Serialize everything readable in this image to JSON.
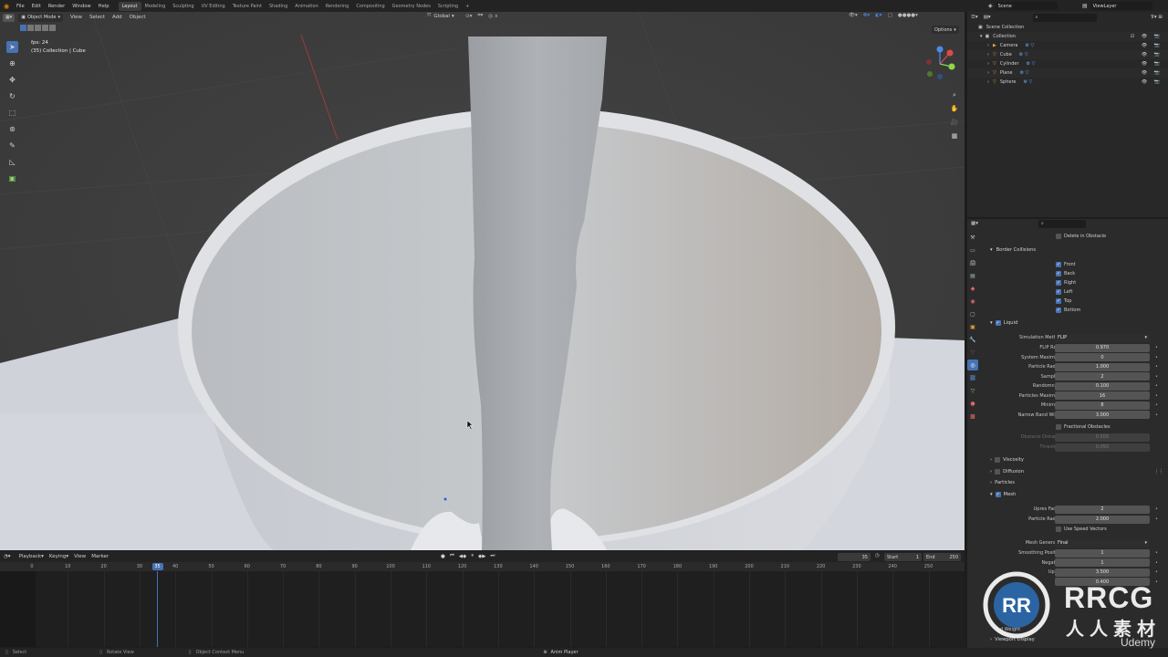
{
  "topbar": {
    "menus": [
      "File",
      "Edit",
      "Render",
      "Window",
      "Help"
    ],
    "workspaces": [
      "Layout",
      "Modeling",
      "Sculpting",
      "UV Editing",
      "Texture Paint",
      "Shading",
      "Animation",
      "Rendering",
      "Compositing",
      "Geometry Nodes",
      "Scripting"
    ],
    "active_workspace": "Layout",
    "add_workspace": "+",
    "scene": "Scene",
    "view_layer": "ViewLayer"
  },
  "viewport": {
    "mode": "Object Mode",
    "menus": [
      "View",
      "Select",
      "Add",
      "Object"
    ],
    "transform_orientation": "Global",
    "options_label": "Options",
    "overlay_fps": "fps: 24",
    "overlay_info": "(35) Collection | Cube"
  },
  "outliner": {
    "scene_collection": "Scene Collection",
    "collection": "Collection",
    "items": [
      {
        "label": "Camera",
        "icon": "camera-icon"
      },
      {
        "label": "Cube",
        "icon": "mesh-icon"
      },
      {
        "label": "Cylinder",
        "icon": "mesh-icon"
      },
      {
        "label": "Plane",
        "icon": "mesh-icon"
      },
      {
        "label": "Sphere",
        "icon": "mesh-icon"
      }
    ]
  },
  "properties": {
    "delete_in_obstacle": "Delete in Obstacle",
    "border_collisions": {
      "title": "Border Collisions",
      "items": [
        "Front",
        "Back",
        "Right",
        "Left",
        "Top",
        "Bottom"
      ]
    },
    "liquid": {
      "title": "Liquid",
      "simulation_method_label": "Simulation Method",
      "simulation_method": "FLIP",
      "fields": [
        {
          "label": "FLIP Ratio",
          "value": "0.970"
        },
        {
          "label": "System Maximum",
          "value": "0"
        },
        {
          "label": "Particle Radius",
          "value": "1.000"
        },
        {
          "label": "Sampling",
          "value": "2"
        },
        {
          "label": "Randomness",
          "value": "0.100"
        },
        {
          "label": "Particles Maximum",
          "value": "16"
        },
        {
          "label": "Minimum",
          "value": "8"
        },
        {
          "label": "Narrow Band Width",
          "value": "3.000"
        }
      ],
      "fractional_obstacles": "Fractional Obstacles",
      "obstacle_distance_label": "Obstacle Distance",
      "obstacle_distance": "0.500",
      "threshold_label": "Threshold",
      "threshold": "0.050"
    },
    "collapsed_panels": [
      "Viscosity",
      "Diffusion",
      "Particles"
    ],
    "mesh": {
      "title": "Mesh",
      "fields": [
        {
          "label": "Upres Factor",
          "value": "2"
        },
        {
          "label": "Particle Radius",
          "value": "2.000"
        }
      ],
      "use_speed_vectors": "Use Speed Vectors",
      "generator_label": "Mesh Generator",
      "generator": "Final",
      "fields2": [
        {
          "label": "Smoothing Positive",
          "value": "1"
        },
        {
          "label": "Negative",
          "value": "1"
        },
        {
          "label": "Upper",
          "value": "3.500"
        },
        {
          "label": "",
          "value": "0.400"
        }
      ],
      "partial_label": "d Weight",
      "viewport_display": "Viewport Display"
    }
  },
  "timeline": {
    "menus": [
      "Playback",
      "Keying",
      "View",
      "Marker"
    ],
    "current_frame": "35",
    "start_label": "Start",
    "start": "1",
    "end_label": "End",
    "end": "250",
    "ruler": [
      "0",
      "10",
      "20",
      "30",
      "40",
      "50",
      "60",
      "70",
      "80",
      "90",
      "100",
      "110",
      "120",
      "130",
      "140",
      "150",
      "160",
      "170",
      "180",
      "190",
      "200",
      "210",
      "220",
      "230",
      "240",
      "250"
    ]
  },
  "statusbar": {
    "select": "Select",
    "rotate": "Rotate View",
    "context": "Object Context Menu",
    "anim": "Anim Player"
  },
  "watermark": {
    "brand": "RRCG",
    "cn": "人人素材",
    "udemy": "Udemy"
  },
  "colors": {
    "accent": "#4772b3",
    "viewport_bg": "#3d3d3d",
    "panel_bg": "#2b2b2b",
    "playhead": "#4772b3"
  }
}
